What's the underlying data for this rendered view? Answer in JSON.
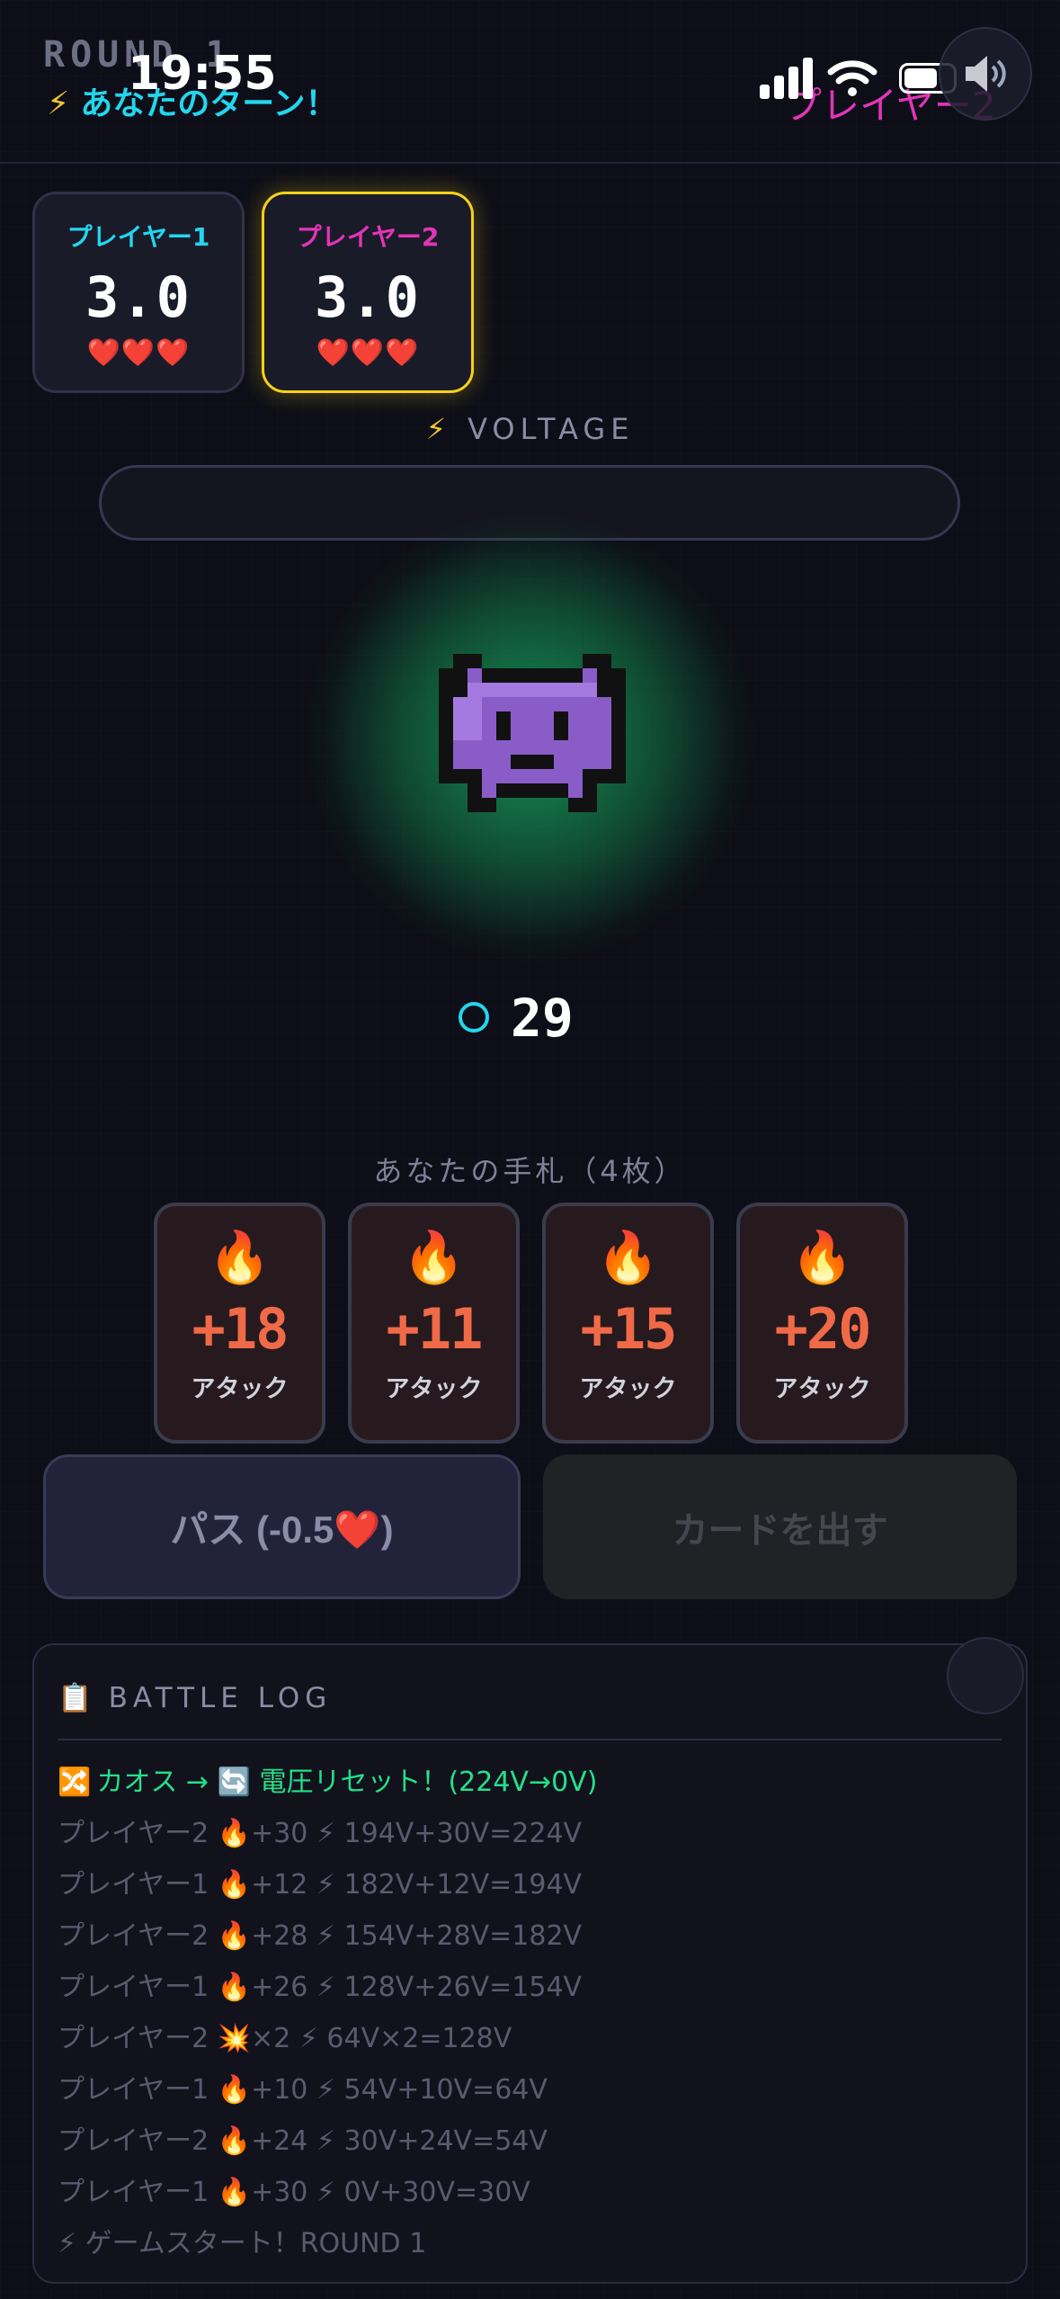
{
  "header": {
    "round": "ROUND 1",
    "turn_text": "あなたのターン！",
    "opponent_label": "プレイヤー2",
    "sound_icon": "speaker-icon"
  },
  "status_bar": {
    "time": "19:55"
  },
  "players": [
    {
      "name": "プレイヤー1",
      "score": "3.0",
      "lives": "❤️❤️❤️",
      "color": "#23d6ee",
      "active": false
    },
    {
      "name": "プレイヤー2",
      "score": "3.0",
      "lives": "❤️❤️❤️",
      "color": "#e235b8",
      "active": true
    }
  ],
  "voltage": {
    "label": "VOLTAGE",
    "level": 0
  },
  "monster": {
    "icon": "alien-monster-icon",
    "glow_color": "#18bc68"
  },
  "counter": {
    "value": "29"
  },
  "hand": {
    "label": "あなたの手札（4枚）",
    "cards": [
      {
        "value": "+18",
        "type": "アタック",
        "icon": "fire-icon"
      },
      {
        "value": "+11",
        "type": "アタック",
        "icon": "fire-icon"
      },
      {
        "value": "+15",
        "type": "アタック",
        "icon": "fire-icon"
      },
      {
        "value": "+20",
        "type": "アタック",
        "icon": "fire-icon"
      }
    ]
  },
  "actions": {
    "pass_label": "パス (-0.5❤️)",
    "play_label": "カードを出す"
  },
  "log": {
    "title": "BATTLE LOG",
    "entries": [
      {
        "icon": "🔀",
        "text": "カオス → 🔄 電圧リセット！(224V→0V)",
        "highlight": true
      },
      {
        "icon": "",
        "text": "プレイヤー2 🔥+30 ⚡ 194V+30V=224V",
        "highlight": false
      },
      {
        "icon": "",
        "text": "プレイヤー1 🔥+12 ⚡ 182V+12V=194V",
        "highlight": false
      },
      {
        "icon": "",
        "text": "プレイヤー2 🔥+28 ⚡ 154V+28V=182V",
        "highlight": false
      },
      {
        "icon": "",
        "text": "プレイヤー1 🔥+26 ⚡ 128V+26V=154V",
        "highlight": false
      },
      {
        "icon": "",
        "text": "プレイヤー2 💥×2 ⚡ 64V×2=128V",
        "highlight": false
      },
      {
        "icon": "",
        "text": "プレイヤー1 🔥+10 ⚡ 54V+10V=64V",
        "highlight": false
      },
      {
        "icon": "",
        "text": "プレイヤー2 🔥+24 ⚡ 30V+24V=54V",
        "highlight": false
      },
      {
        "icon": "",
        "text": "プレイヤー1 🔥+30 ⚡ 0V+30V=30V",
        "highlight": false
      },
      {
        "icon": "",
        "text": "⚡ ゲームスタート！ROUND 1",
        "highlight": false
      }
    ]
  }
}
